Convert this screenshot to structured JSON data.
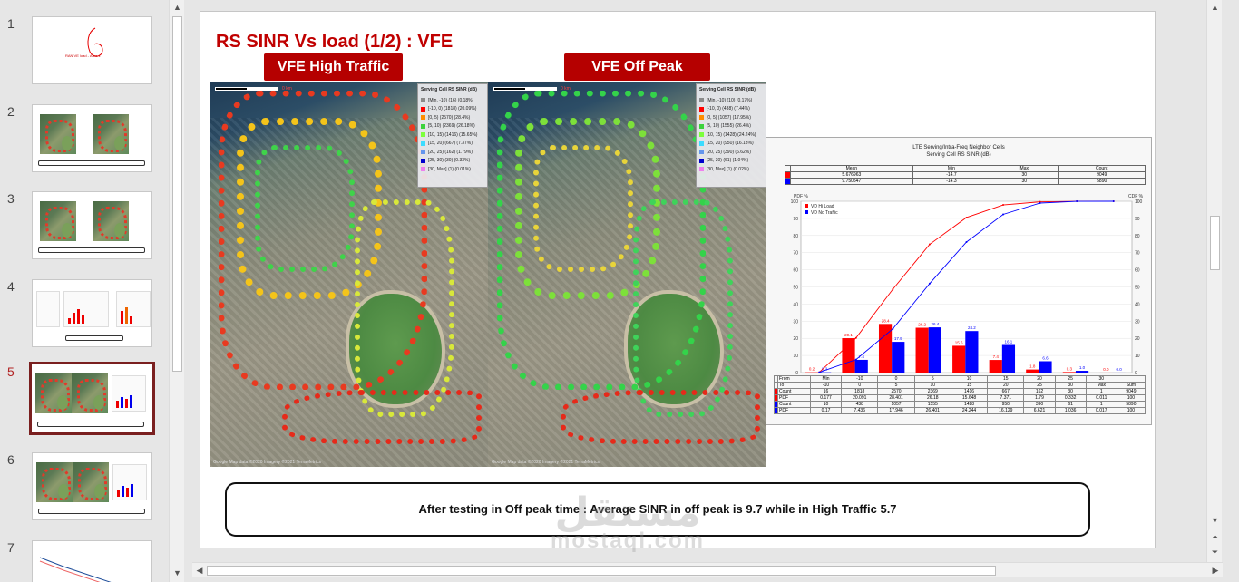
{
  "thumbnails": [
    {
      "num": "1",
      "caption": "RAN VE load - Area 1",
      "type": "title"
    },
    {
      "num": "2",
      "type": "maps"
    },
    {
      "num": "3",
      "type": "maps"
    },
    {
      "num": "4",
      "type": "charts"
    },
    {
      "num": "5",
      "type": "maps-chart",
      "active": true
    },
    {
      "num": "6",
      "type": "maps-chart"
    },
    {
      "num": "7",
      "type": "line"
    }
  ],
  "slide": {
    "title": "RS SINR Vs load (1/2) : VFE",
    "tag_left": "VFE High Traffic",
    "tag_right": "VFE Off Peak",
    "caption": "After testing in Off peak time : Average SINR in off peak is 9.7 while in High Traffic 5.7"
  },
  "map_legend": {
    "title": "Serving Cell RS SINR (dB)",
    "left_rows": [
      {
        "range": "[Min, -10)",
        "count": "(16) (0.18%)",
        "color": "#8a8a8a"
      },
      {
        "range": "[-10, 0)",
        "count": "(1818) (20.09%)",
        "color": "#ff0000"
      },
      {
        "range": "[0, 5)",
        "count": "(2570) (28.4%)",
        "color": "#ff8c00"
      },
      {
        "range": "[5, 10)",
        "count": "(2369) (26.18%)",
        "color": "#3cd23c"
      },
      {
        "range": "[10, 15)",
        "count": "(1416) (15.65%)",
        "color": "#7dff3c"
      },
      {
        "range": "[15, 20)",
        "count": "(667) (7.37%)",
        "color": "#3cdcff"
      },
      {
        "range": "[20, 25)",
        "count": "(162) (1.79%)",
        "color": "#6495ed"
      },
      {
        "range": "[25, 30)",
        "count": "(30) (0.33%)",
        "color": "#0000cd"
      },
      {
        "range": "[30, Max]",
        "count": "(1) (0.01%)",
        "color": "#ee82ee"
      }
    ],
    "right_rows": [
      {
        "range": "[Min, -10)",
        "count": "(10) (0.17%)",
        "color": "#8a8a8a"
      },
      {
        "range": "[-10, 0)",
        "count": "(438) (7.44%)",
        "color": "#ff0000"
      },
      {
        "range": "[0, 5)",
        "count": "(1057) (17.95%)",
        "color": "#ff8c00"
      },
      {
        "range": "[5, 10)",
        "count": "(1555) (26.4%)",
        "color": "#3cd23c"
      },
      {
        "range": "[10, 15)",
        "count": "(1428) (24.24%)",
        "color": "#7dff3c"
      },
      {
        "range": "[15, 20)",
        "count": "(950) (16.13%)",
        "color": "#3cdcff"
      },
      {
        "range": "[20, 25)",
        "count": "(390) (6.62%)",
        "color": "#6495ed"
      },
      {
        "range": "[25, 30)",
        "count": "(61) (1.04%)",
        "color": "#0000cd"
      },
      {
        "range": "[30, Max]",
        "count": "(1) (0.02%)",
        "color": "#ee82ee"
      }
    ],
    "scale_left": "0 km",
    "scale_right": "0 km",
    "credit": "Google Map data ©2020 Imagery ©2021 TerraMetrics"
  },
  "chart_data": {
    "type": "bar",
    "title": "LTE Serving/Intra-Freq Neighbor Cells",
    "subtitle": "Serving Cell RS SINR (dB)",
    "stats_header": [
      "Mean",
      "Min",
      "Max",
      "Count"
    ],
    "stats_rows": [
      {
        "mean": "5.676963",
        "min": "-14.7",
        "max": "30",
        "count": "9049",
        "color": "#ff0000"
      },
      {
        "mean": "9.750547",
        "min": "-14.3",
        "max": "30",
        "count": "5890",
        "color": "#0000ff"
      }
    ],
    "ylabel_left": "PDF %",
    "ylabel_right": "CDF %",
    "ylim": [
      0,
      100
    ],
    "y_ticks": [
      "0",
      "10",
      "20",
      "30",
      "40",
      "50",
      "60",
      "70",
      "80",
      "90",
      "100"
    ],
    "categories": [
      "Min",
      "-10",
      "0",
      "5",
      "10",
      "15",
      "20",
      "25",
      "30"
    ],
    "series": [
      {
        "name": "VD Hi Load",
        "color": "#ff0000",
        "pdf": [
          0.177,
          20.091,
          28.401,
          26.18,
          15.648,
          7.371,
          1.79,
          0.332,
          0.011
        ],
        "cdf": [
          0.177,
          20.268,
          48.669,
          74.849,
          90.497,
          97.868,
          99.658,
          99.99,
          100
        ]
      },
      {
        "name": "VD No Traffic",
        "color": "#0000ff",
        "pdf": [
          0.17,
          7.436,
          17.946,
          26.401,
          24.244,
          16.129,
          6.621,
          1.036,
          0.017
        ],
        "cdf": [
          0.17,
          7.606,
          25.552,
          51.953,
          76.197,
          92.326,
          98.947,
          99.983,
          100
        ]
      }
    ],
    "bar_labels_red": [
      "0.2",
      "20.1",
      "28.4",
      "26.2",
      "15.6",
      "7.4",
      "1.8",
      "0.3",
      "0.0"
    ],
    "bar_labels_blue": [
      "0.2",
      "7.4",
      "17.9",
      "26.4",
      "24.2",
      "16.1",
      "6.6",
      "1.0",
      "0.0"
    ],
    "table": {
      "from": [
        "Min",
        "-10",
        "0",
        "5",
        "10",
        "15",
        "20",
        "25",
        "30"
      ],
      "to": [
        "-10",
        "0",
        "5",
        "10",
        "15",
        "20",
        "25",
        "30",
        "Max"
      ],
      "red_count": [
        "16",
        "1818",
        "2570",
        "2369",
        "1416",
        "667",
        "162",
        "30",
        "1",
        "9049"
      ],
      "red_pdf": [
        "0.177",
        "20.091",
        "28.401",
        "26.18",
        "15.648",
        "7.371",
        "1.79",
        "0.332",
        "0.011",
        "100"
      ],
      "blue_count": [
        "10",
        "438",
        "1057",
        "1555",
        "1428",
        "950",
        "390",
        "61",
        "1",
        "5890"
      ],
      "blue_pdf": [
        "0.17",
        "7.436",
        "17.946",
        "26.401",
        "24.244",
        "16.129",
        "6.621",
        "1.036",
        "0.017",
        "100"
      ],
      "sum_label": "Sum"
    }
  },
  "watermark": {
    "top": "مستقل",
    "bottom": "mostaql.com"
  }
}
